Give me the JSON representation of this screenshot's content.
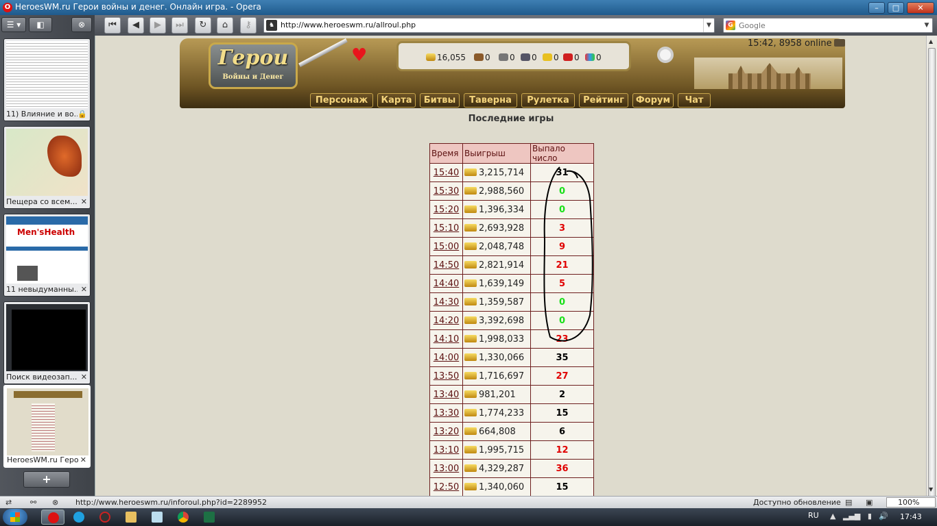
{
  "window": {
    "title": "HeroesWM.ru Герои войны и денег. Онлайн игра. - Opera",
    "minimize": "–",
    "maximize": "□",
    "close": "✕"
  },
  "toolbar": {
    "url": "http://www.heroeswm.ru/allroul.php",
    "search_placeholder": "Google"
  },
  "tabs": [
    {
      "label": "11) Влияние и во..."
    },
    {
      "label": "Пещера со всем..."
    },
    {
      "label": "11 невыдуманны..."
    },
    {
      "label": "Поиск видеозап..."
    },
    {
      "label": "HeroesWM.ru Геро..."
    }
  ],
  "thumbnail_text": {
    "menshealth": "Men'sHealth"
  },
  "game": {
    "logo_main": "Герои",
    "logo_sub": "Войны и Денег",
    "resources": {
      "gold": "16,055",
      "wood": "0",
      "ore": "0",
      "mercury": "0",
      "sulfur": "0",
      "crystals": "0",
      "gems": "0"
    },
    "clock": "15:42, 8958 online",
    "menu": [
      "Персонаж",
      "Карта",
      "Битвы",
      "Таверна",
      "Рулетка",
      "Рейтинг",
      "Форум",
      "Чат"
    ]
  },
  "page_title": "Последние игры",
  "table": {
    "headers": [
      "Время",
      "Выигрыш",
      "Выпало число"
    ],
    "rows": [
      {
        "time": "15:40",
        "win": "3,215,714",
        "number": "31",
        "color": "black"
      },
      {
        "time": "15:30",
        "win": "2,988,560",
        "number": "0",
        "color": "green"
      },
      {
        "time": "15:20",
        "win": "1,396,334",
        "number": "0",
        "color": "green"
      },
      {
        "time": "15:10",
        "win": "2,693,928",
        "number": "3",
        "color": "red"
      },
      {
        "time": "15:00",
        "win": "2,048,748",
        "number": "9",
        "color": "red"
      },
      {
        "time": "14:50",
        "win": "2,821,914",
        "number": "21",
        "color": "red"
      },
      {
        "time": "14:40",
        "win": "1,639,149",
        "number": "5",
        "color": "red"
      },
      {
        "time": "14:30",
        "win": "1,359,587",
        "number": "0",
        "color": "green"
      },
      {
        "time": "14:20",
        "win": "3,392,698",
        "number": "0",
        "color": "green"
      },
      {
        "time": "14:10",
        "win": "1,998,033",
        "number": "23",
        "color": "red"
      },
      {
        "time": "14:00",
        "win": "1,330,066",
        "number": "35",
        "color": "black"
      },
      {
        "time": "13:50",
        "win": "1,716,697",
        "number": "27",
        "color": "red"
      },
      {
        "time": "13:40",
        "win": "981,201",
        "number": "2",
        "color": "black"
      },
      {
        "time": "13:30",
        "win": "1,774,233",
        "number": "15",
        "color": "black"
      },
      {
        "time": "13:20",
        "win": "664,808",
        "number": "6",
        "color": "black"
      },
      {
        "time": "13:10",
        "win": "1,995,715",
        "number": "12",
        "color": "red"
      },
      {
        "time": "13:00",
        "win": "4,329,287",
        "number": "36",
        "color": "red"
      },
      {
        "time": "12:50",
        "win": "1,340,060",
        "number": "15",
        "color": "black"
      }
    ]
  },
  "statusbar": {
    "url": "http://www.heroeswm.ru/inforoul.php?id=2289952",
    "update": "Доступно обновление",
    "zoom": "100%"
  },
  "taskbar": {
    "lang": "RU",
    "clock": "17:43"
  },
  "colors": {
    "red": "#e00000",
    "green": "#19e019",
    "black": "#000000",
    "header_bg": "#eec6c1",
    "border": "#6c1d1d"
  }
}
